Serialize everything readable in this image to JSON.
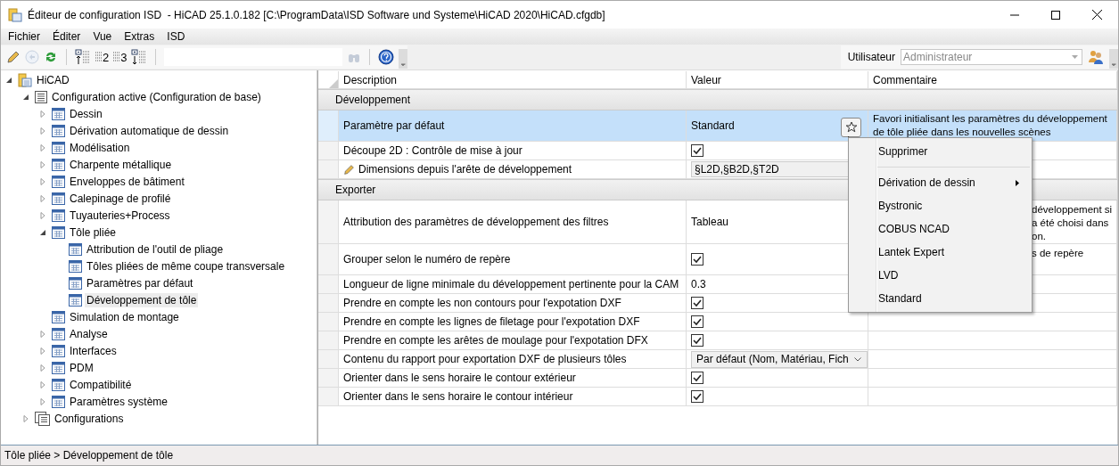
{
  "window": {
    "title": "Éditeur de configuration ISD  - HiCAD 25.1.0.182 [C:\\ProgramData\\ISD Software und Systeme\\HiCAD 2020\\HiCAD.cfgdb]"
  },
  "menu_bar": [
    "Fichier",
    "Éditer",
    "Vue",
    "Extras",
    "ISD"
  ],
  "toolbar": {
    "level_buttons": [
      "2",
      "3"
    ],
    "user_label": "Utilisateur",
    "user_value": "Administrateur"
  },
  "tree": [
    {
      "label": "HiCAD",
      "kind": "root",
      "expanded": true,
      "selected": false,
      "children": [
        {
          "label": "Configuration active (Configuration de base)",
          "kind": "config",
          "expanded": true,
          "selected": false,
          "children": [
            {
              "label": "Dessin",
              "kind": "section",
              "expanded": false,
              "selected": false
            },
            {
              "label": "Dérivation automatique de dessin",
              "kind": "section",
              "expanded": false,
              "selected": false
            },
            {
              "label": "Modélisation",
              "kind": "section",
              "expanded": false,
              "selected": false
            },
            {
              "label": "Charpente métallique",
              "kind": "section",
              "expanded": false,
              "selected": false
            },
            {
              "label": "Enveloppes de bâtiment",
              "kind": "section",
              "expanded": false,
              "selected": false
            },
            {
              "label": "Calepinage de profilé",
              "kind": "section",
              "expanded": false,
              "selected": false
            },
            {
              "label": "Tuyauteries+Process",
              "kind": "section",
              "expanded": false,
              "selected": false
            },
            {
              "label": "Tôle pliée",
              "kind": "section",
              "expanded": true,
              "selected": false,
              "children": [
                {
                  "label": "Attribution de l'outil de pliage",
                  "kind": "section",
                  "selected": false
                },
                {
                  "label": "Tôles pliées de même coupe transversale",
                  "kind": "section",
                  "selected": false
                },
                {
                  "label": "Paramètres par défaut",
                  "kind": "section",
                  "selected": false
                },
                {
                  "label": "Développement de tôle",
                  "kind": "section",
                  "selected": true
                }
              ]
            },
            {
              "label": "Simulation de montage",
              "kind": "section",
              "selected": false
            },
            {
              "label": "Analyse",
              "kind": "section",
              "expanded": false,
              "selected": false
            },
            {
              "label": "Interfaces",
              "kind": "section",
              "expanded": false,
              "selected": false
            },
            {
              "label": "PDM",
              "kind": "section",
              "expanded": false,
              "selected": false
            },
            {
              "label": "Compatibilité",
              "kind": "section",
              "expanded": false,
              "selected": false
            },
            {
              "label": "Paramètres système",
              "kind": "section",
              "expanded": false,
              "selected": false
            }
          ]
        },
        {
          "label": "Configurations",
          "kind": "configs",
          "expanded": false,
          "selected": false
        }
      ]
    }
  ],
  "grid": {
    "columns": [
      "Description",
      "Valeur",
      "Commentaire"
    ],
    "groups": [
      {
        "title": "Développement",
        "rows": [
          {
            "description": "Paramètre par défaut",
            "kind": "text",
            "value": "Standard",
            "selected": true,
            "modified": false,
            "comment": "Favori initialisant les paramètres du développement de tôle pliée dans les nouvelles scènes",
            "comment_clipped": false
          },
          {
            "description": "Découpe 2D : Contrôle de mise à jour",
            "kind": "check",
            "checked": true,
            "selected": false,
            "modified": false
          },
          {
            "description": "Dimensions depuis l'arête de développement",
            "kind": "edit",
            "value": "§L2D,§B2D,§T2D",
            "selected": false,
            "modified": true
          }
        ]
      },
      {
        "title": "Exporter",
        "rows": [
          {
            "description": "Attribution des paramètres de développement des filtres",
            "kind": "text",
            "value": "Tableau",
            "selected": false,
            "modified": false,
            "comment": "développement si\na été choisi dans\non.",
            "comment_clipped": true
          },
          {
            "description": "Grouper selon le numéro de repère",
            "kind": "check",
            "checked": true,
            "selected": false,
            "modified": false,
            "comment": "s de repère",
            "comment_clipped": true
          },
          {
            "description": "Longueur de ligne minimale du développement pertinente pour la CAM",
            "kind": "text",
            "value": "0.3",
            "selected": false,
            "modified": false
          },
          {
            "description": "Prendre en compte les non contours pour l'expotation DXF",
            "kind": "check",
            "checked": true,
            "selected": false,
            "modified": false
          },
          {
            "description": "Prendre en compte les lignes de filetage pour l'expotation DXF",
            "kind": "check",
            "checked": true,
            "selected": false,
            "modified": false
          },
          {
            "description": "Prendre en compte les arêtes de moulage pour l'expotation DFX",
            "kind": "check",
            "checked": true,
            "selected": false,
            "modified": false
          },
          {
            "description": "Contenu du rapport pour exportation DXF de plusieurs tôles",
            "kind": "dropdown",
            "value": "Par défaut (Nom, Matériau, Fich",
            "selected": false,
            "modified": false
          },
          {
            "description": "Orienter dans le sens horaire le contour extérieur",
            "kind": "check",
            "checked": true,
            "selected": false,
            "modified": false
          },
          {
            "description": "Orienter dans le sens horaire le contour intérieur",
            "kind": "check",
            "checked": true,
            "selected": false,
            "modified": false
          }
        ]
      }
    ]
  },
  "context_menu": {
    "items": [
      {
        "kind": "item",
        "label": "Supprimer"
      },
      {
        "kind": "separator"
      },
      {
        "kind": "submenu",
        "label": "Dérivation de dessin"
      },
      {
        "kind": "item",
        "label": "Bystronic"
      },
      {
        "kind": "item",
        "label": "COBUS NCAD"
      },
      {
        "kind": "item",
        "label": "Lantek Expert"
      },
      {
        "kind": "item",
        "label": "LVD"
      },
      {
        "kind": "item",
        "label": "Standard"
      }
    ]
  },
  "status_bar": "Tôle pliée > Développement de tôle"
}
